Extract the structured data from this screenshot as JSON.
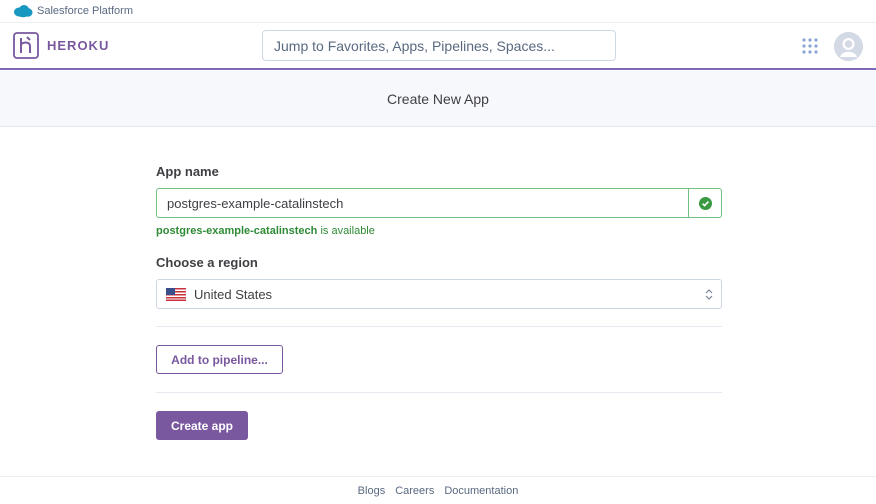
{
  "salesforce_bar": {
    "label": "Salesforce Platform"
  },
  "header": {
    "logo_text": "HEROKU",
    "search": {
      "placeholder": "Jump to Favorites, Apps, Pipelines, Spaces...",
      "value": ""
    }
  },
  "page": {
    "title": "Create New App"
  },
  "form": {
    "app_name_label": "App name",
    "app_name_value": "postgres-example-catalinstech",
    "availability": {
      "name": "postgres-example-catalinstech",
      "suffix": " is available"
    },
    "region_label": "Choose a region",
    "region_selected": "United States",
    "add_pipeline_label": "Add to pipeline...",
    "create_label": "Create app"
  },
  "footer": {
    "links": [
      "Blogs",
      "Careers",
      "Documentation"
    ]
  },
  "colors": {
    "brand": "#79589f",
    "success": "#2e8b36",
    "border": "#cfd7e6"
  }
}
